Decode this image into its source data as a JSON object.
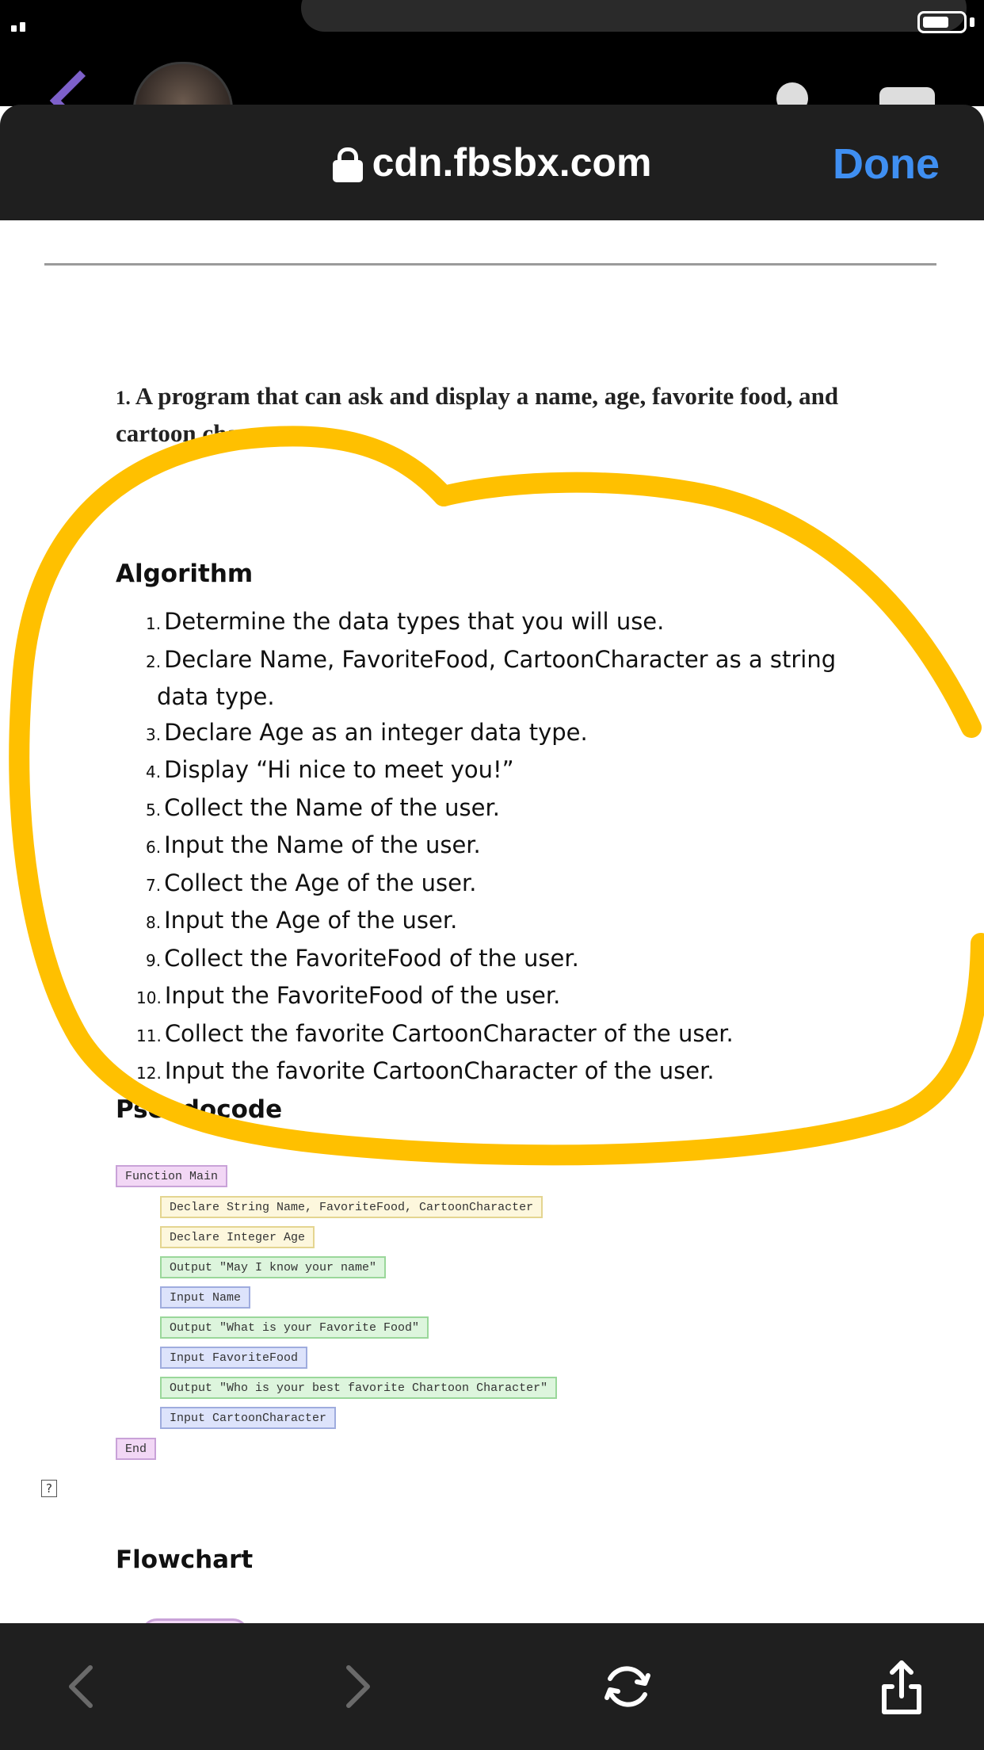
{
  "browser": {
    "url": "cdn.fbsbx.com",
    "done_label": "Done"
  },
  "document": {
    "question_number": "1.",
    "question_text": "A program that can ask and display a name, age, favorite food, and cartoon character.",
    "algorithm_heading": "Algorithm",
    "algorithm_steps": [
      {
        "num": "1.",
        "text": "Determine the data types that you will use."
      },
      {
        "num": "2.",
        "text": "Declare Name, FavoriteFood, CartoonCharacter as a string",
        "text_cont": "data type."
      },
      {
        "num": "3.",
        "text": "Declare Age as an integer data type."
      },
      {
        "num": "4.",
        "text": "Display “Hi nice to meet you!”"
      },
      {
        "num": "5.",
        "text": "Collect the Name of the user."
      },
      {
        "num": "6.",
        "text": "Input the Name of the user."
      },
      {
        "num": "7.",
        "text": "Collect the Age of the user."
      },
      {
        "num": "8.",
        "text": "Input the Age of the user."
      },
      {
        "num": "9.",
        "text": "Collect the FavoriteFood of the user."
      },
      {
        "num": "10.",
        "text": "Input the FavoriteFood of the user."
      },
      {
        "num": "11.",
        "text": "Collect the favorite CartoonCharacter of the user."
      },
      {
        "num": "12.",
        "text": "Input the favorite CartoonCharacter of the user."
      }
    ],
    "pseudocode_heading": "Pseudocode",
    "pseudocode": [
      "Function Main",
      "Declare String Name, FavoriteFood, CartoonCharacter",
      "Declare Integer Age",
      "Output \"May I know your name\"",
      "Input Name",
      "Output \"What is your Favorite Food\"",
      "Input FavoriteFood",
      "Output \"Who is your best favorite Chartoon Character\"",
      "Input CartoonCharacter",
      "End"
    ],
    "broken_image_glyph": "?",
    "flowchart_heading": "Flowchart"
  },
  "colors": {
    "annotation": "#FFC000",
    "done_blue": "#3f8ff2",
    "sheet_dark": "#1f1f1f",
    "pc_purple": "#f2d7f5",
    "pc_yellow": "#fdf7dd",
    "pc_green": "#ddf5dd",
    "pc_blue": "#dde3fb"
  },
  "icons": {
    "lock": "lock-icon",
    "back": "chevron-left-icon",
    "forward": "chevron-right-icon",
    "reload": "reload-icon",
    "share": "share-icon"
  }
}
